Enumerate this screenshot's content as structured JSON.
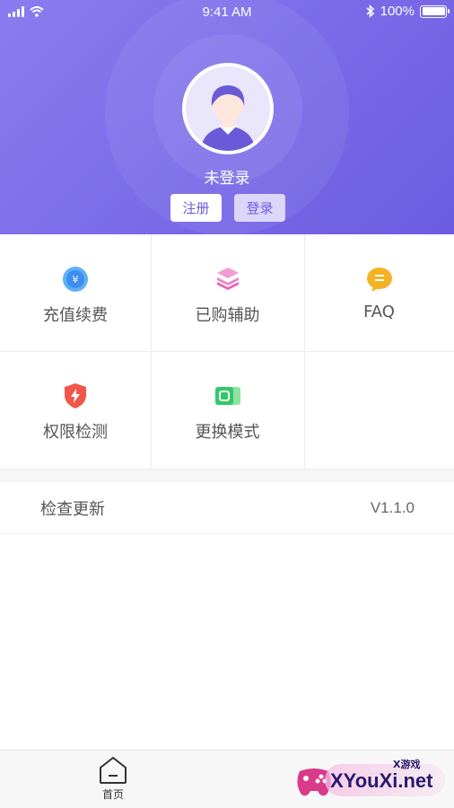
{
  "status_bar": {
    "time": "9:41 AM",
    "battery": "100%"
  },
  "profile": {
    "status_text": "未登录",
    "register_label": "注册",
    "login_label": "登录"
  },
  "menu": {
    "recharge": "充值续费",
    "purchased": "已购辅助",
    "faq": "FAQ",
    "permission": "权限检测",
    "mode": "更换模式"
  },
  "update": {
    "label": "检查更新",
    "version": "V1.1.0"
  },
  "tabbar": {
    "home_label": "首页"
  },
  "watermark": {
    "text": "XYouXi.net",
    "sub": "X游戏"
  },
  "colors": {
    "header": "#7a6ae8",
    "accent": "#6c5ce0"
  }
}
